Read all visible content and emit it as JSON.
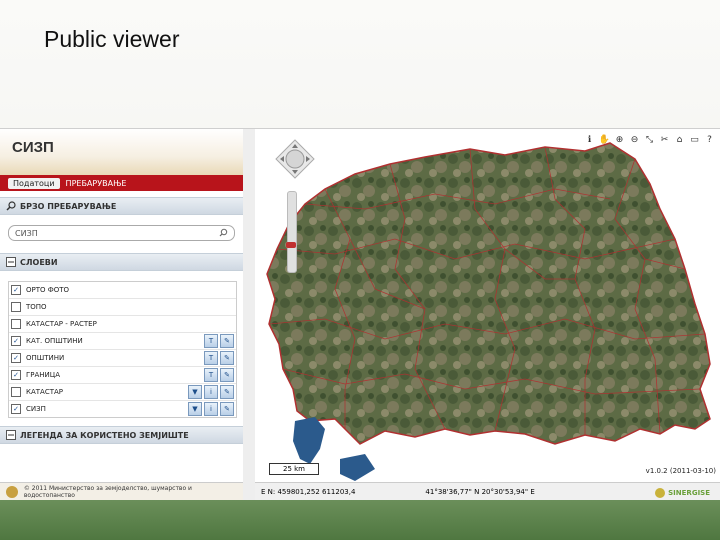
{
  "slide": {
    "title": "Public viewer"
  },
  "panel": {
    "logo": "СИЗП",
    "tabs": [
      "Податоци",
      "ПРЕБАРУВАЊЕ"
    ],
    "quick_search": {
      "header": "БРЗО ПРЕБАРУВАЊЕ",
      "value": "СИЗП"
    },
    "layers": {
      "header": "СЛОЕВИ",
      "items": [
        {
          "label": "ОРТО ФОТО",
          "checked": true,
          "buttons": 0
        },
        {
          "label": "ТОПО",
          "checked": false,
          "buttons": 0
        },
        {
          "label": "КАТАСТАР - РАСТЕР",
          "checked": false,
          "buttons": 0
        },
        {
          "label": "КАТ. ОПШТИНИ",
          "checked": true,
          "buttons": 2
        },
        {
          "label": "ОПШТИНИ",
          "checked": true,
          "buttons": 2
        },
        {
          "label": "ГРАНИЦА",
          "checked": true,
          "buttons": 2
        },
        {
          "label": "КАТАСТАР",
          "checked": false,
          "buttons": 3
        },
        {
          "label": "СИЗП",
          "checked": true,
          "buttons": 3
        }
      ]
    },
    "legend_header": "ЛЕГЕНДА ЗА КОРИСТЕНО ЗЕМЈИШТЕ",
    "footer_text": "© 2011 Министерство за земјоделство, шумарство и водостопанство"
  },
  "map": {
    "scale": "25 km",
    "version": "v1.0.2 (2011-03-10)",
    "coords_en": "E N: 459801,252 611203,4",
    "coords_latlon": "41°38'36,77\" N 20°30'53,94\" E",
    "brand": "SINERGISE",
    "toolbar_icons": [
      "info-icon",
      "pan-icon",
      "zoom-in-icon",
      "zoom-out-icon",
      "select-icon",
      "tools-icon",
      "home-icon",
      "print-icon",
      "help-icon"
    ]
  }
}
